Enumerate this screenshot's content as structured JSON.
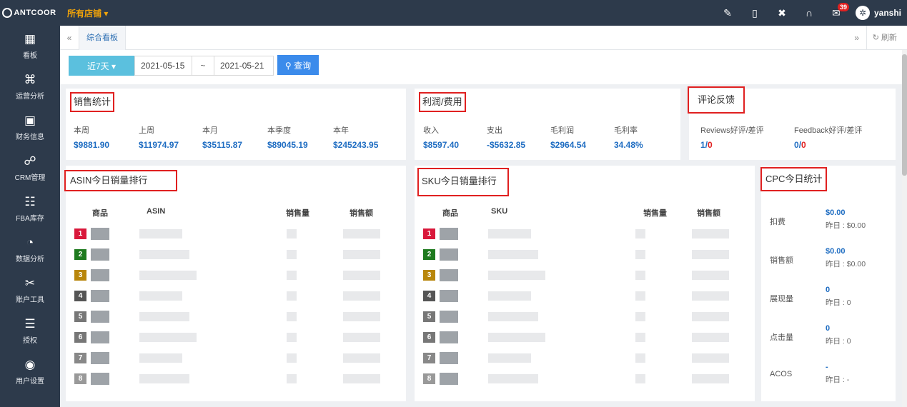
{
  "app": {
    "logo_text": "ANTCOOR",
    "store_select": "所有店铺 ▾"
  },
  "topbar": {
    "icons": [
      "pin-icon",
      "mobile-icon",
      "expand-icon",
      "headset-icon",
      "mail-icon"
    ],
    "mail_count": "39",
    "username": "yanshi"
  },
  "sidebar": {
    "items": [
      {
        "label": "看板",
        "icon": "dashboard-icon",
        "glyph": "▦"
      },
      {
        "label": "运营分析",
        "icon": "network-icon",
        "glyph": "⌘"
      },
      {
        "label": "财务信息",
        "icon": "money-icon",
        "glyph": "▣"
      },
      {
        "label": "CRM管理",
        "icon": "handshake-icon",
        "glyph": "☍"
      },
      {
        "label": "FBA库存",
        "icon": "users-icon",
        "glyph": "☷"
      },
      {
        "label": "数据分析",
        "icon": "pie-icon",
        "glyph": "◔"
      },
      {
        "label": "账户工具",
        "icon": "tools-icon",
        "glyph": "✂"
      },
      {
        "label": "授权",
        "icon": "sliders-icon",
        "glyph": "☰"
      },
      {
        "label": "用户设置",
        "icon": "user-icon",
        "glyph": "◉"
      }
    ]
  },
  "tabs": {
    "active": "综合看板",
    "refresh": "刷新"
  },
  "filter": {
    "range_button": "近7天 ▾",
    "start_date": "2021-05-15",
    "separator": "~",
    "end_date": "2021-05-21",
    "query_button": "查询"
  },
  "sales": {
    "title": "销售统计",
    "stats": [
      {
        "label": "本周",
        "value": "$9881.90"
      },
      {
        "label": "上周",
        "value": "$11974.97"
      },
      {
        "label": "本月",
        "value": "$35115.87"
      },
      {
        "label": "本季度",
        "value": "$89045.19"
      },
      {
        "label": "本年",
        "value": "$245243.95"
      }
    ]
  },
  "profit": {
    "title": "利润/费用",
    "stats": [
      {
        "label": "收入",
        "value": "$8597.40"
      },
      {
        "label": "支出",
        "value": "-$5632.85"
      },
      {
        "label": "毛利润",
        "value": "$2964.54"
      },
      {
        "label": "毛利率",
        "value": "34.48%"
      }
    ]
  },
  "review": {
    "title": "评论反馈",
    "stats": [
      {
        "label": "Reviews好评/差评",
        "good": "1",
        "sep": "/",
        "bad": "0"
      },
      {
        "label": "Feedback好评/差评",
        "good": "0",
        "sep": "/",
        "bad": "0"
      }
    ]
  },
  "asin_rank": {
    "title": "ASIN今日销量排行",
    "headers": [
      "商品",
      "ASIN",
      "销售量",
      "销售额"
    ],
    "ranks": [
      "1",
      "2",
      "3",
      "4",
      "5",
      "6",
      "7",
      "8"
    ]
  },
  "sku_rank": {
    "title": "SKU今日销量排行",
    "headers": [
      "商品",
      "SKU",
      "销售量",
      "销售额"
    ],
    "ranks": [
      "1",
      "2",
      "3",
      "4",
      "5",
      "6",
      "7",
      "8"
    ]
  },
  "rank_colors": [
    "#d9183b",
    "#1e7a1e",
    "#b8860b",
    "#555555",
    "#777777",
    "#777777",
    "#888888",
    "#999999"
  ],
  "cpc": {
    "title": "CPC今日统计",
    "rows": [
      {
        "label": "扣费",
        "value": "$0.00",
        "prev": "昨日 : $0.00"
      },
      {
        "label": "销售额",
        "value": "$0.00",
        "prev": "昨日 : $0.00"
      },
      {
        "label": "展现量",
        "value": "0",
        "prev": "昨日 : 0"
      },
      {
        "label": "点击量",
        "value": "0",
        "prev": "昨日 : 0"
      },
      {
        "label": "ACOS",
        "value": "-",
        "prev": "昨日 : -"
      }
    ]
  }
}
